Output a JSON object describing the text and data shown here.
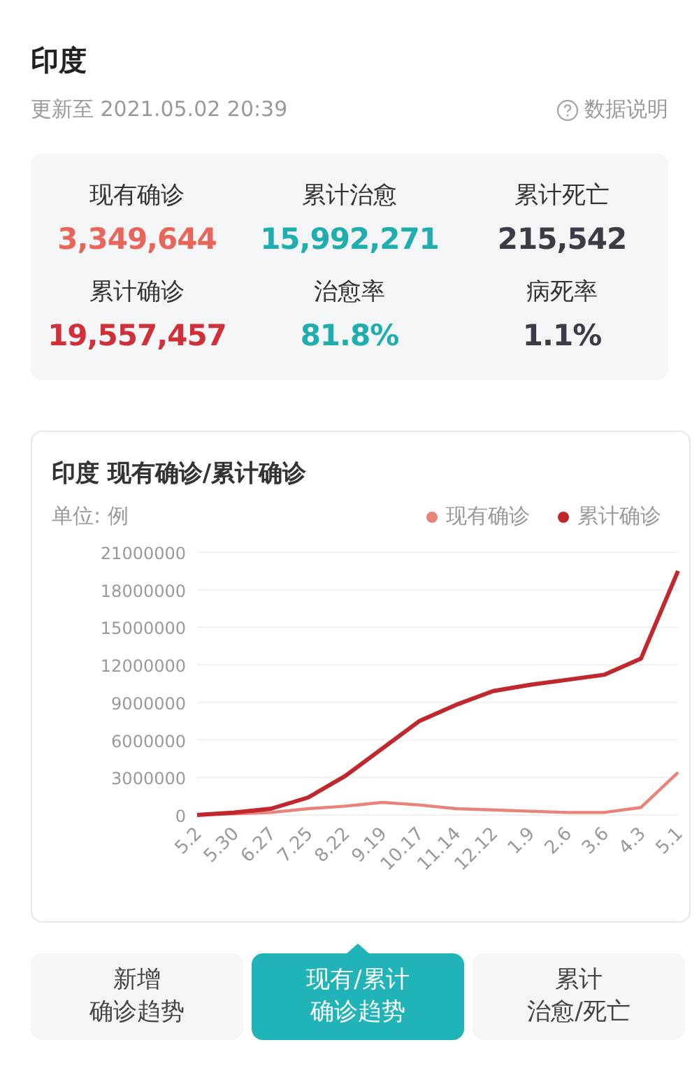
{
  "header": {
    "title": "印度",
    "updated": "更新至 2021.05.02 20:39",
    "help_link": "数据说明"
  },
  "stats": [
    {
      "label": "现有确诊",
      "value": "3,349,644",
      "color": "#e8655a"
    },
    {
      "label": "累计治愈",
      "value": "15,992,271",
      "color": "#1fadad"
    },
    {
      "label": "累计死亡",
      "value": "215,542",
      "color": "#3a3d45"
    },
    {
      "label": "累计确诊",
      "value": "19,557,457",
      "color": "#d0303a"
    },
    {
      "label": "治愈率",
      "value": "81.8%",
      "color": "#1fadad"
    },
    {
      "label": "病死率",
      "value": "1.1%",
      "color": "#3a3d45"
    }
  ],
  "chart_card": {
    "title": "印度 现有确诊/累计确诊",
    "unit": "单位: 例",
    "chart_data": {
      "type": "line",
      "categories": [
        "5.2",
        "5.30",
        "6.27",
        "7.25",
        "8.22",
        "9.19",
        "10.17",
        "11.14",
        "12.12",
        "1.9",
        "2.6",
        "3.6",
        "4.3",
        "5.1"
      ],
      "grid": true,
      "ylim": [
        0,
        21000000
      ],
      "yticks": [
        0,
        3000000,
        6000000,
        9000000,
        12000000,
        15000000,
        18000000,
        21000000
      ],
      "series": [
        {
          "name": "现有确诊",
          "color": "#e8837a",
          "values": [
            0,
            100000,
            200000,
            500000,
            700000,
            1000000,
            800000,
            500000,
            400000,
            300000,
            200000,
            200000,
            600000,
            3400000
          ]
        },
        {
          "name": "累计确诊",
          "color": "#c0282d",
          "values": [
            0,
            200000,
            500000,
            1400000,
            3100000,
            5300000,
            7500000,
            8800000,
            9900000,
            10400000,
            10800000,
            11200000,
            12500000,
            19500000
          ]
        }
      ]
    }
  },
  "tabs": [
    {
      "lines": [
        "新增",
        "确诊趋势"
      ],
      "selected": false
    },
    {
      "lines": [
        "现有/累计",
        "确诊趋势"
      ],
      "selected": true
    },
    {
      "lines": [
        "累计",
        "治愈/死亡"
      ],
      "selected": false
    }
  ]
}
